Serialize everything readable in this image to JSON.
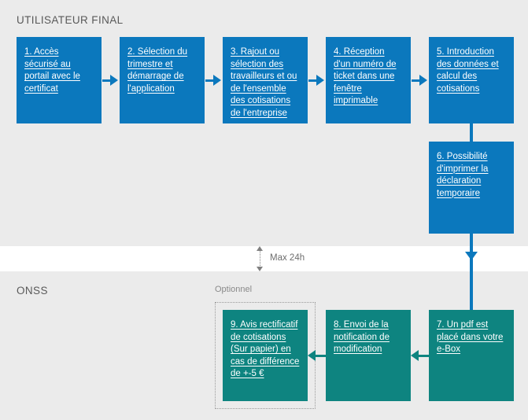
{
  "diagram": {
    "title_top_band": "UTILISATEUR FINAL",
    "title_bottom_band": "ONSS",
    "optional_label": "Optionnel",
    "duration_label": "Max 24h",
    "colors": {
      "blue": "#0b78bd",
      "teal": "#0e8480",
      "band_background": "#ebebeb",
      "mid_band_background": "#ffffff",
      "band_title_text": "#595959",
      "optional_text": "#8a8a8a",
      "duration_text": "#6e6e6e",
      "node_text": "#ffffff"
    }
  },
  "nodes": {
    "n1": "1. Accès sécurisé au portail avec le certificat",
    "n2": "2. Sélection du trimestre et démarrage de l'application",
    "n3": "3. Rajout ou sélection des travailleurs et ou de l'ensemble des cotisations de l'entreprise",
    "n4": "4. Réception d'un numéro de ticket dans une fenêtre imprimable",
    "n5": "5. Introduction des données et calcul des cotisations",
    "n6": "6. Possibilité d'imprimer la déclaration temporaire",
    "n7": "7. Un pdf est placé dans votre e-Box",
    "n8": "8. Envoi de la notification de modification",
    "n9": "9. Avis rectificatif de cotisations (Sur papier) en cas de différence de +-5 €"
  }
}
